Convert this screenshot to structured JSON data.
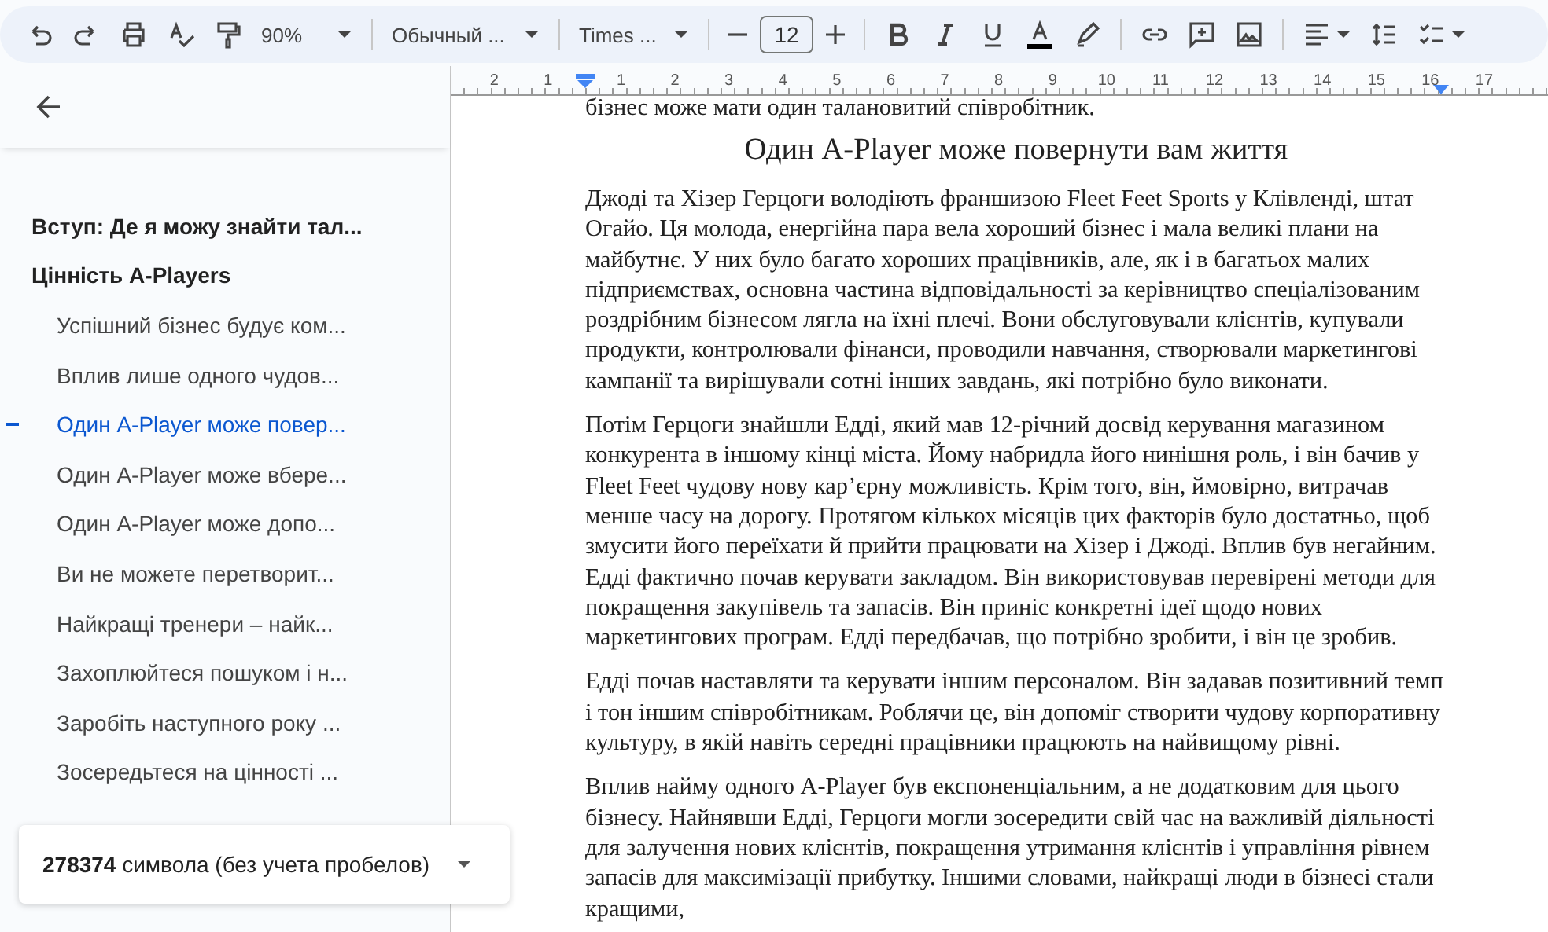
{
  "toolbar": {
    "zoom": "90%",
    "style": "Обычный ...",
    "font": "Times ...",
    "font_size": "12"
  },
  "ruler": {
    "left_labels": [
      "2",
      "1"
    ],
    "right_labels": [
      "1",
      "2",
      "3",
      "4",
      "5",
      "6",
      "7",
      "8",
      "9",
      "10",
      "11",
      "12",
      "13",
      "14",
      "15",
      "16",
      "17"
    ]
  },
  "outline": {
    "items": [
      {
        "label": "Вступ: Де я можу знайти тал...",
        "kind": "top",
        "selected": false
      },
      {
        "label": "Цінність A-Players",
        "kind": "top",
        "selected": false
      },
      {
        "label": "Успішний бізнес будує ком...",
        "kind": "sub",
        "selected": false
      },
      {
        "label": "Вплив лише одного чудов...",
        "kind": "sub",
        "selected": false
      },
      {
        "label": "Один A-Player може повер...",
        "kind": "sub",
        "selected": true
      },
      {
        "label": "Один A-Player може вбере...",
        "kind": "sub",
        "selected": false
      },
      {
        "label": "Один A-Player може допо...",
        "kind": "sub",
        "selected": false
      },
      {
        "label": "Ви не можете перетворит...",
        "kind": "sub",
        "selected": false
      },
      {
        "label": "Найкращі тренери – найк...",
        "kind": "sub",
        "selected": false
      },
      {
        "label": "Захоплюйтеся пошуком і н...",
        "kind": "sub",
        "selected": false
      },
      {
        "label": "Заробіть наступного року ...",
        "kind": "sub",
        "selected": false
      },
      {
        "label": "Зосередьтеся на цінності ...",
        "kind": "sub",
        "selected": false
      }
    ]
  },
  "word_count": {
    "text": "**278374** символа (без учета пробелов)"
  },
  "document": {
    "cut_line": "бізнес може мати один талановитий співробітник.",
    "heading": "Один A-Player може повернути вам життя",
    "paragraphs": [
      "Джоді та Хізер Герцоги володіють франшизою Fleet Feet Sports у Клівленді, штат Огайо. Ця молода, енергійна пара вела хороший бізнес і мала великі плани на майбутнє. У них було багато хороших працівників, але, як і в багатьох малих підприємствах, основна частина відповідальності за керівництво спеціалізованим роздрібним бізнесом лягла на їхні плечі. Вони обслуговували клієнтів, купували продукти, контролювали фінанси, проводили навчання, створювали маркетингові кампанії та вирішували сотні інших завдань, які потрібно було виконати.",
      "Потім Герцоги знайшли Едді, який мав 12-річний досвід керування магазином конкурента в іншому кінці міста. Йому набридла його нинішня роль, і він бачив у Fleet Feet чудову нову кар’єрну можливість. Крім того, він, ймовірно, витрачав менше часу на дорогу. Протягом кількох місяців цих факторів було достатньо, щоб змусити його переїхати й прийти працювати на Хізер і Джоді. Вплив був негайним. Едді фактично почав керувати закладом. Він використовував перевірені методи для покращення закупівель та запасів. Він приніс конкретні ідеї щодо нових маркетингових програм. Едді передбачав, що потрібно зробити, і він це зробив.",
      "Едді почав наставляти та керувати іншим персоналом. Він задавав позитивний темп і тон іншим співробітникам. Роблячи це, він допоміг створити чудову корпоративну культуру, в якій навіть середні працівники працюють на найвищому рівні.",
      "Вплив найму одного A-Player був експоненціальним, а не додатковим для цього бізнесу. Найнявши Едді, Герцоги могли зосередити свій час на важливій діяльності для залучення нових клієнтів, покращення утримання клієнтів і управління рівнем запасів для максимізації прибутку. Іншими словами, найкращі люди в бізнесі стали кращими,"
    ]
  }
}
